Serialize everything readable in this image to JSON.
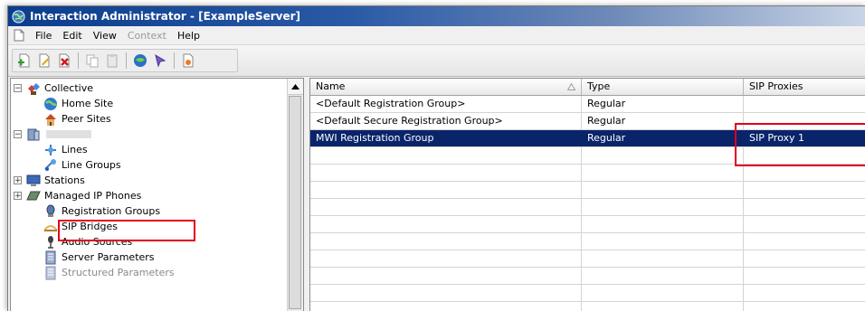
{
  "window": {
    "title": "Interaction Administrator - [ExampleServer]"
  },
  "menu": [
    "File",
    "Edit",
    "View",
    "Context",
    "Help"
  ],
  "menu_disabled": [
    false,
    false,
    false,
    true,
    false
  ],
  "tree": {
    "items": [
      {
        "label": "Collective"
      },
      {
        "label": "Home Site"
      },
      {
        "label": "Peer Sites"
      },
      {
        "label": ""
      },
      {
        "label": "Lines"
      },
      {
        "label": "Line Groups"
      },
      {
        "label": "Stations"
      },
      {
        "label": "Managed IP Phones"
      },
      {
        "label": "Registration Groups"
      },
      {
        "label": "SIP Bridges"
      },
      {
        "label": "Audio Sources"
      },
      {
        "label": "Server Parameters"
      },
      {
        "label": "Structured Parameters"
      }
    ]
  },
  "list": {
    "columns": [
      "Name",
      "Type",
      "SIP Proxies"
    ],
    "rows": [
      {
        "name": "<Default Registration Group>",
        "type": "Regular",
        "proxies": ""
      },
      {
        "name": "<Default Secure Registration Group>",
        "type": "Regular",
        "proxies": ""
      },
      {
        "name": "MWI Registration Group",
        "type": "Regular",
        "proxies": "SIP Proxy 1"
      }
    ],
    "selected_row": 2
  },
  "colors": {
    "selection": "#0a246a",
    "highlight": "#e0001b",
    "titlebar": "#0b3d8c"
  }
}
